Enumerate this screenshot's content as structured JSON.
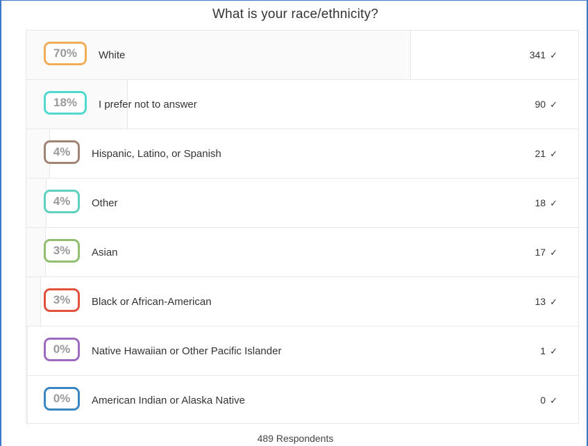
{
  "chart_data": {
    "type": "bar",
    "title": "What is your race/ethnicity?",
    "categories": [
      "White",
      "I prefer not to answer",
      "Hispanic, Latino, or Spanish",
      "Other",
      "Asian",
      "Black or African-American",
      "Native Hawaiian or Other Pacific Islander",
      "American Indian or Alaska Native"
    ],
    "percent_labels": [
      "70%",
      "18%",
      "4%",
      "4%",
      "3%",
      "3%",
      "0%",
      "0%"
    ],
    "values": [
      341,
      90,
      21,
      18,
      17,
      13,
      1,
      0
    ],
    "colors": [
      "#f0ad55",
      "#4fd9d0",
      "#a08574",
      "#5cd1c0",
      "#8fbf6f",
      "#e0503a",
      "#9c6bbf",
      "#3a86c0"
    ],
    "total": 489,
    "footer": "489 Respondents"
  },
  "check_symbol": "✓"
}
